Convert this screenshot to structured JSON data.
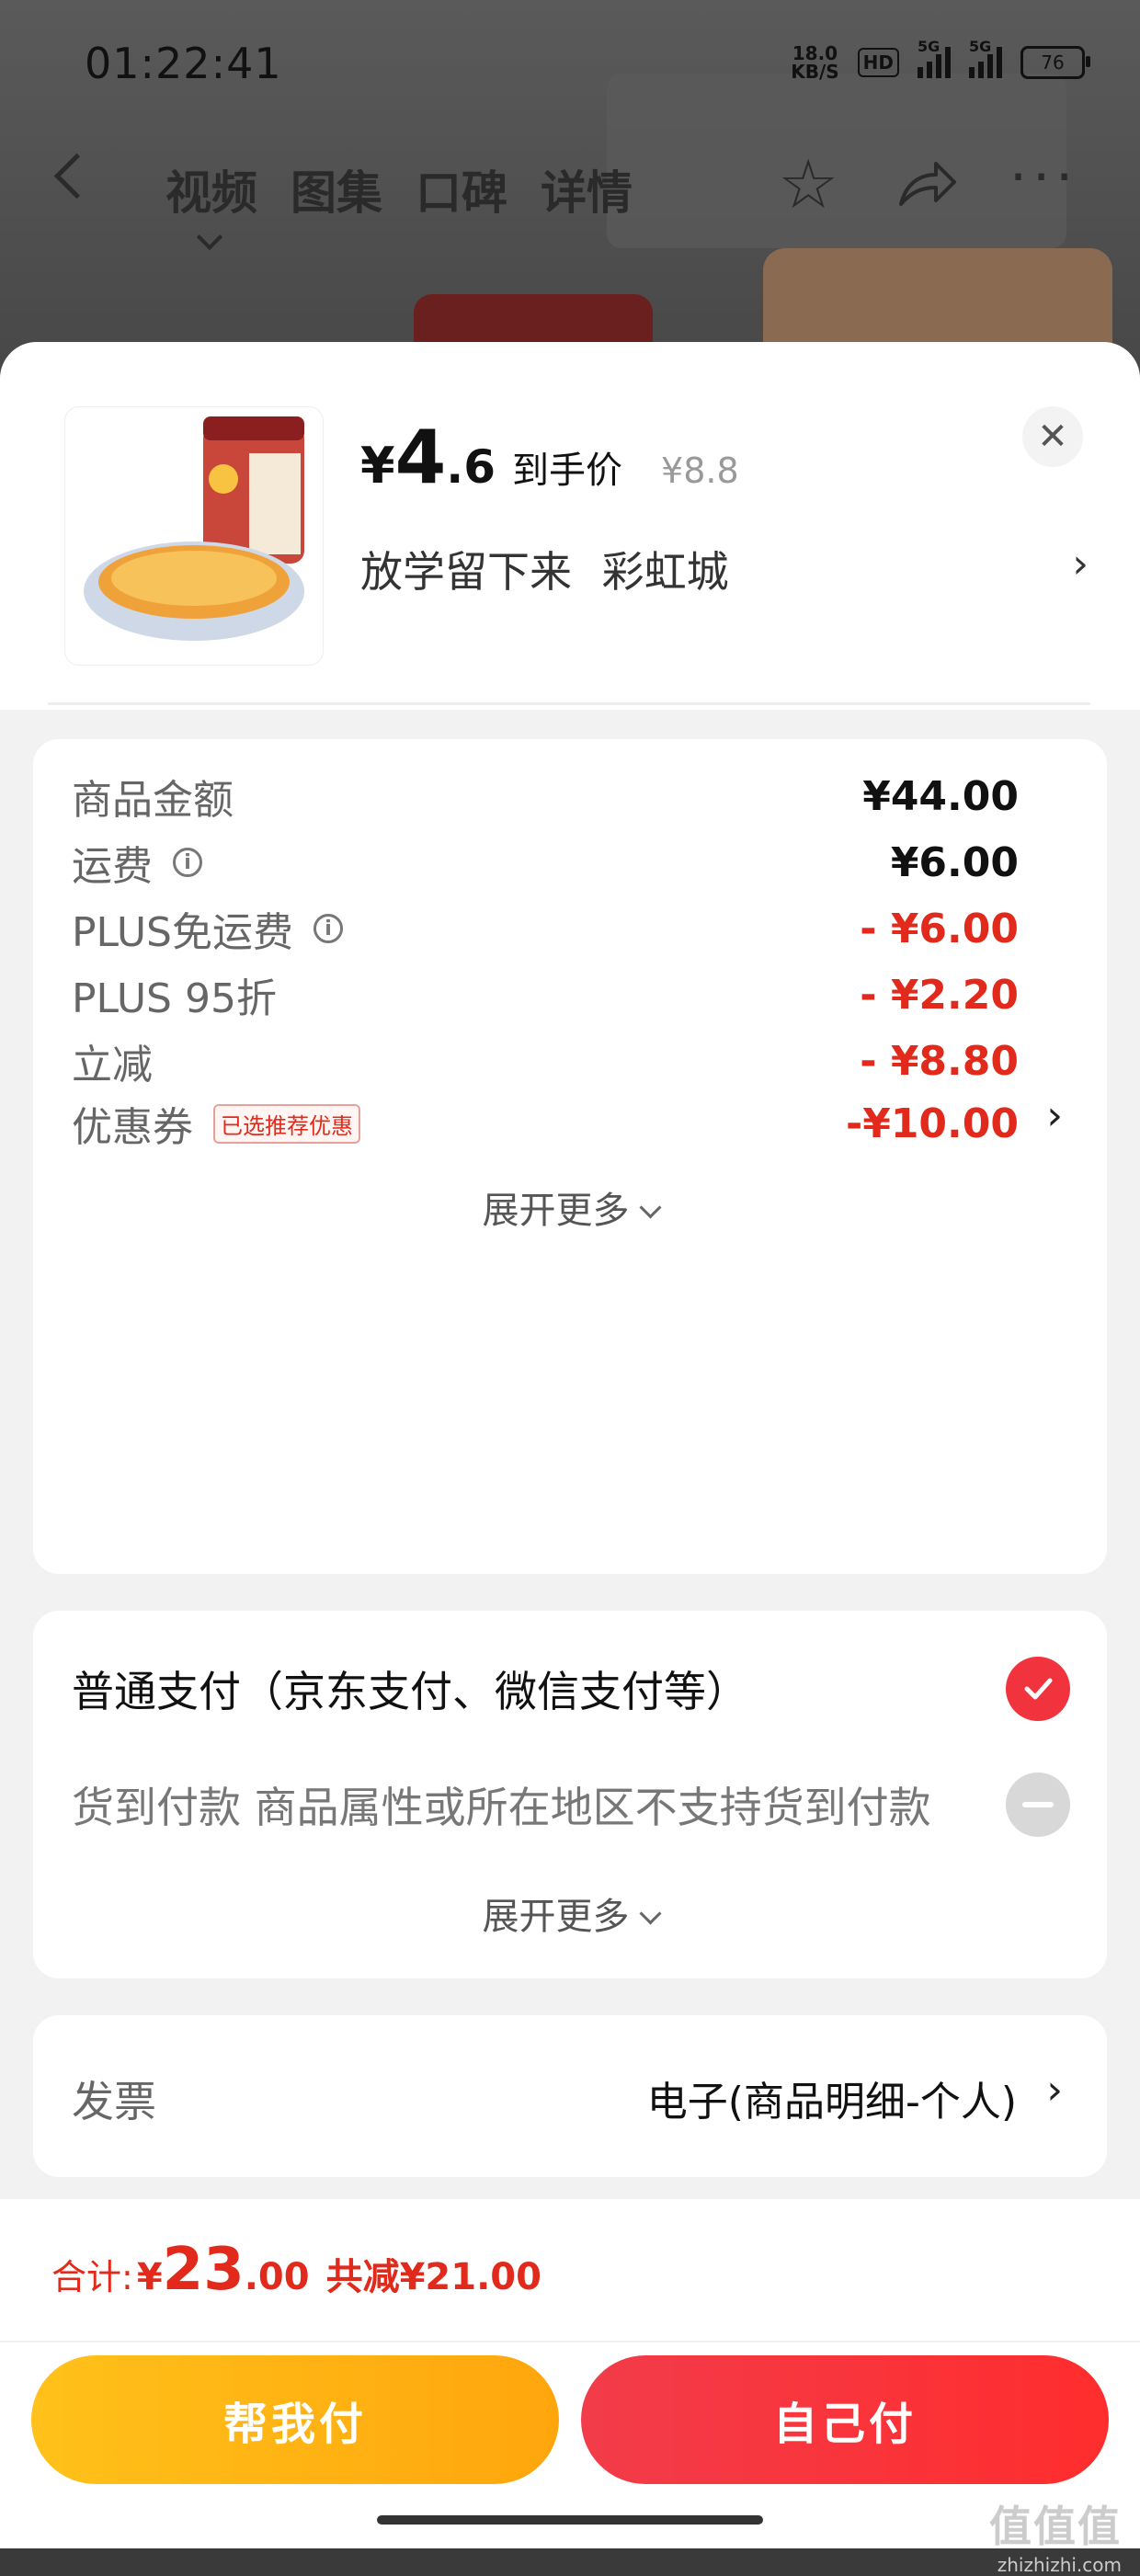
{
  "status_bar": {
    "time": "01:22:41",
    "net_speed_value": "18.0",
    "net_speed_unit": "KB/S",
    "hd": "HD",
    "signal1": "5G",
    "signal2": "5G",
    "battery": "76"
  },
  "nav": {
    "tabs": [
      "视频",
      "图集",
      "口碑",
      "详情"
    ],
    "active_tab": 0
  },
  "product": {
    "price_symbol": "¥",
    "price_integer": "4",
    "price_decimal": ".6",
    "price_label": "到手价",
    "original_price": "¥8.8",
    "shop_name": "放学留下来 彩虹城"
  },
  "fees": {
    "rows": [
      {
        "label": "商品金额",
        "value": "¥44.00",
        "red": false
      },
      {
        "label": "运费",
        "value": "¥6.00",
        "red": false,
        "info": true
      },
      {
        "label": "PLUS免运费",
        "value": "- ¥6.00",
        "red": true,
        "info": true
      },
      {
        "label": "PLUS 95折",
        "value": "- ¥2.20",
        "red": true
      },
      {
        "label": "立减",
        "value": "- ¥8.80",
        "red": true
      },
      {
        "label": "优惠券",
        "value": "-¥10.00",
        "red": true
      }
    ],
    "coupon_tag": "已选推荐优惠",
    "expand_label": "展开更多"
  },
  "payment": {
    "normal": "普通支付（京东支付、微信支付等）",
    "cod": "货到付款 商品属性或所在地区不支持货到付款",
    "expand_label": "展开更多"
  },
  "invoice": {
    "label": "发票",
    "value": "电子(商品明细-个人)"
  },
  "footer": {
    "total_label": "合计:",
    "total_yen": "¥",
    "total_int": "23",
    "total_dec": ".00",
    "saved": "共减¥21.00",
    "help_pay": "帮我付",
    "self_pay": "自己付"
  },
  "watermark": {
    "line1": "值值值",
    "line2": "zhizhizhi.com"
  },
  "colors": {
    "accent_red": "#e12a1b",
    "check_red": "#f0333c",
    "help_btn": "#ffb414",
    "self_btn": "#f5333a"
  }
}
